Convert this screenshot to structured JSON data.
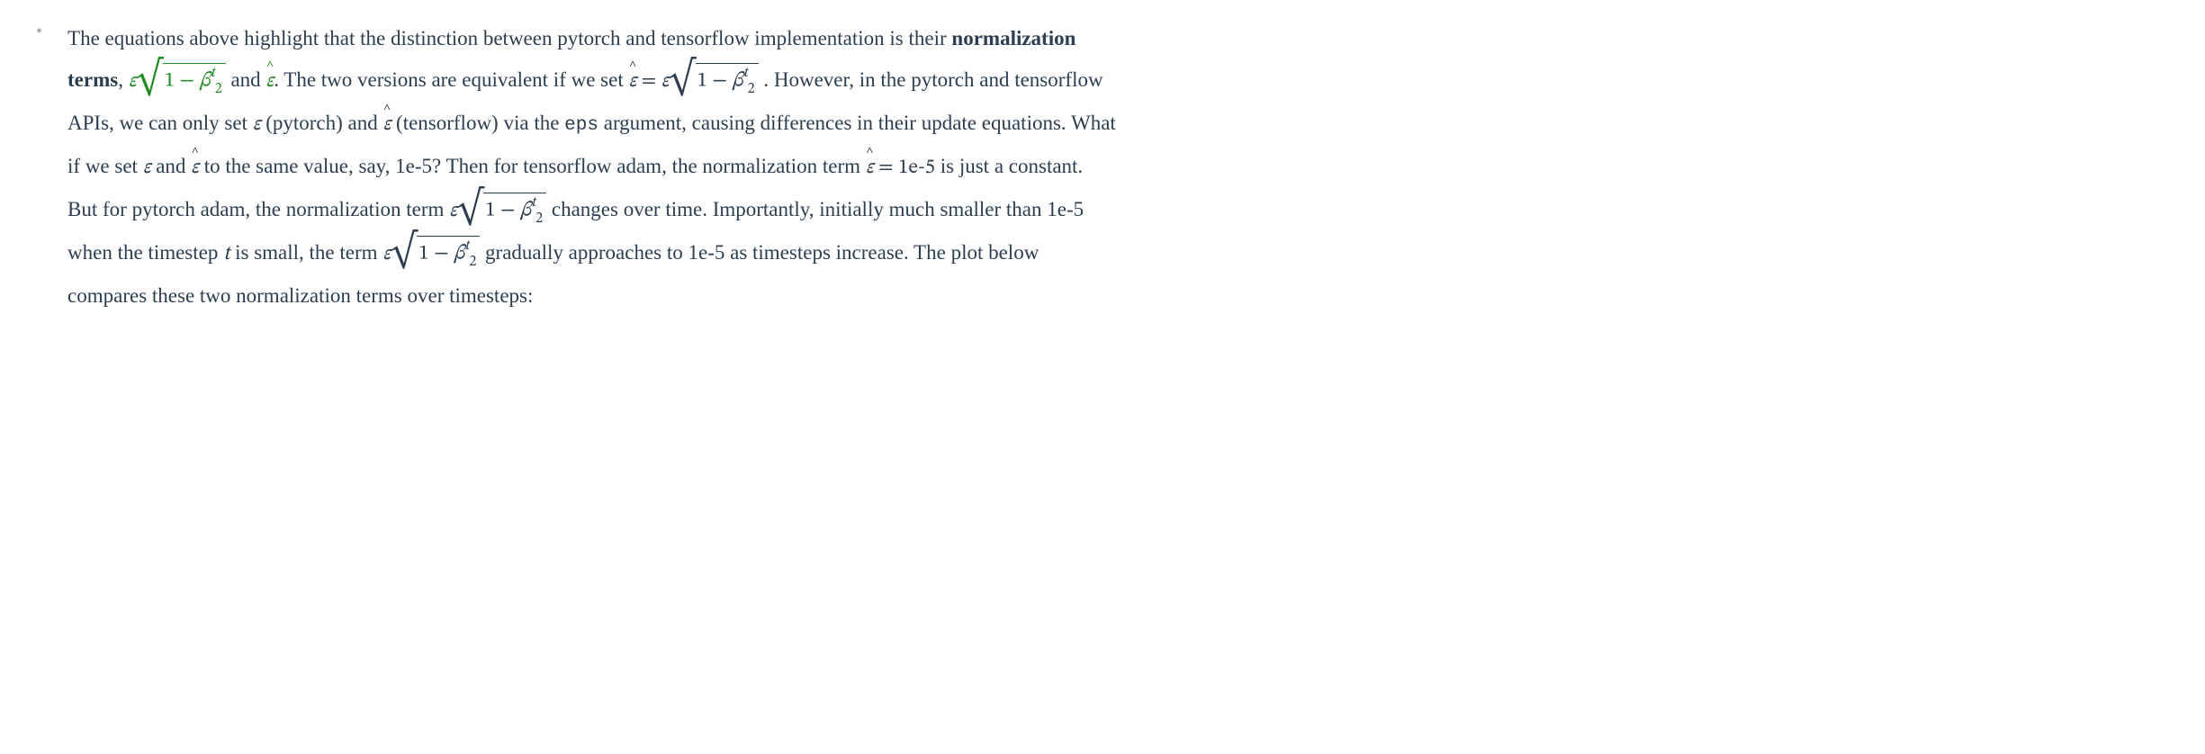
{
  "bullet": "•",
  "text": {
    "t1": "The equations above highlight that the distinction between pytorch and tensorflow implementation is their ",
    "strong1": "normalization terms",
    "t2": ", ",
    "t3": " and ",
    "t4": ". The two versions are equivalent if we set ",
    "t5": " . However, in the pytorch and tensorflow APIs, we can only set ",
    "t6": " (pytorch) and ",
    "t7": " (tensorflow) via the ",
    "code1": "eps",
    "t8": " argument, causing differences in their update equations. What if we set ",
    "t9": " and ",
    "t10": " to the same value, say, 1e-5? Then for tensorflow adam, the normalization term ",
    "t11": " is just a constant. But for pytorch adam, the normalization term ",
    "t12": " changes over time. Importantly, initially much smaller than 1e-5 when the timestep ",
    "t13": " is small, the term ",
    "t14": " gradually approaches to 1e-5 as timesteps increase. The plot below compares these two normalization terms over timesteps:"
  },
  "math": {
    "epsilon": "ε",
    "epsilon_hat_base": "ε",
    "hat_symbol": "^",
    "equals": " = ",
    "one_minus": "1 − ",
    "beta": "β",
    "sub2": "2",
    "supt": "t",
    "t_var": "t",
    "sqrt_sym": "√",
    "val_1e5": "1e-5"
  }
}
